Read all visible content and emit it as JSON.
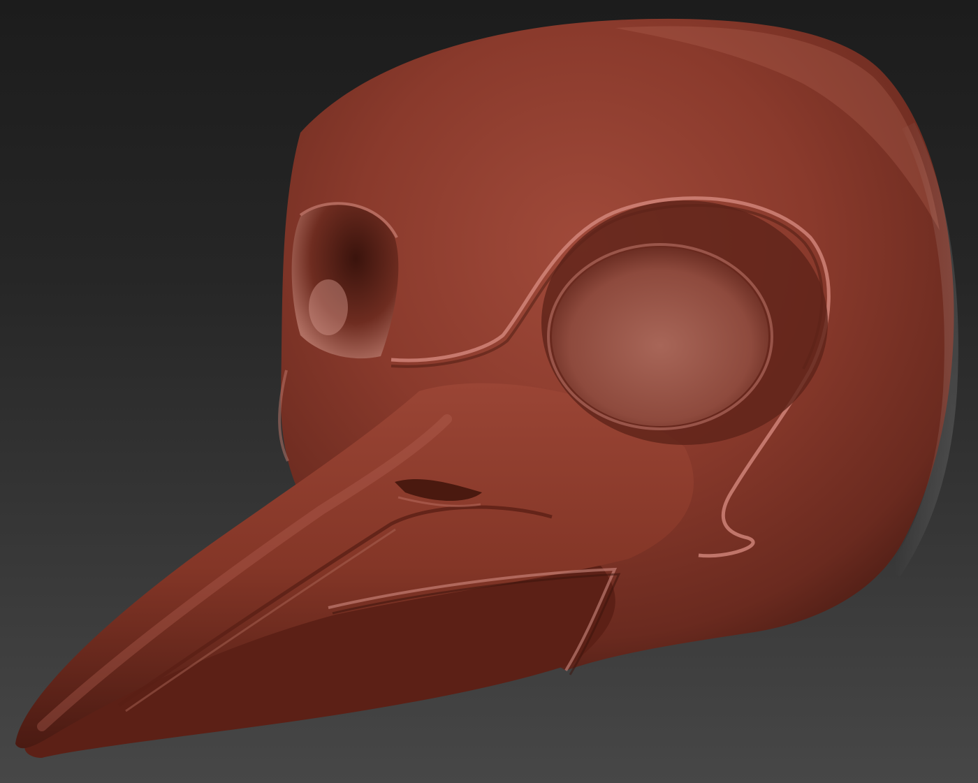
{
  "scene": {
    "subject": "plague-doctor-mask-sculpt",
    "background_top_color": "#1c1c1c",
    "background_bottom_color": "#474747",
    "material_color": "#8a3a2c",
    "material_shadow_color": "#3e160f",
    "material_highlight_color": "#c77a6c"
  }
}
